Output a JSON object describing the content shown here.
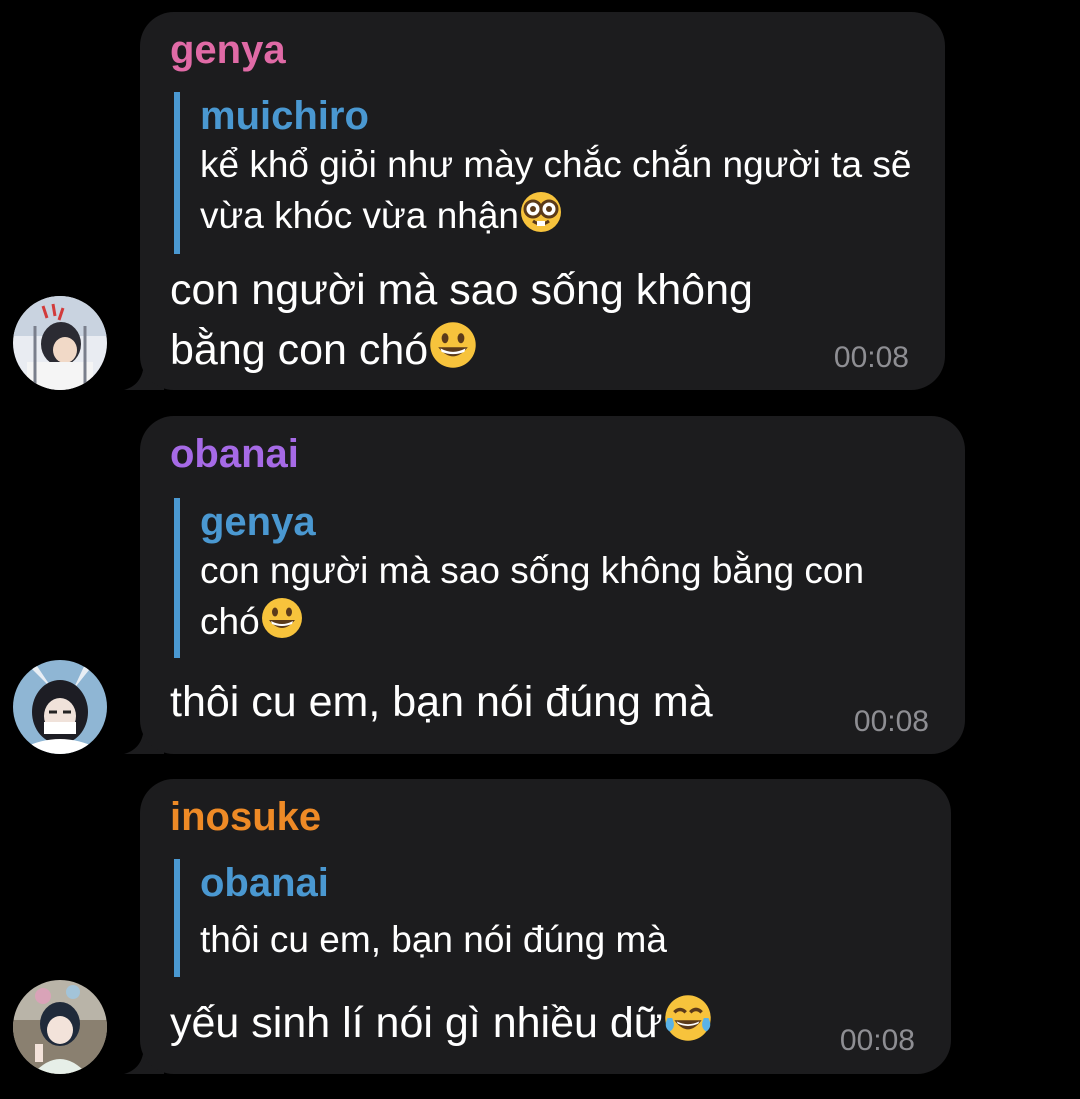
{
  "colors": {
    "background": "#000000",
    "bubble": "#1c1c1e",
    "reply_accent": "#4a98d1",
    "timestamp": "#8e8e93",
    "text": "#ffffff"
  },
  "messages": [
    {
      "sender": "genya",
      "sender_color": "#e06aa6",
      "avatar_icon": "avatar-genya",
      "reply": {
        "author": "muichiro",
        "text": "kể khổ giỏi như mày chắc chắn người ta sẽ vừa khóc vừa nhận",
        "emoji": "nerd-face-emoji"
      },
      "text": "con người mà sao sống không bằng con chó",
      "emoji": "grinning-face-emoji",
      "time": "00:08"
    },
    {
      "sender": "obanai",
      "sender_color": "#a66ae6",
      "avatar_icon": "avatar-obanai",
      "reply": {
        "author": "genya",
        "text": "con người mà sao sống không bằng con chó",
        "emoji": "grinning-face-emoji"
      },
      "text": "thôi cu em, bạn nói đúng mà",
      "emoji": "",
      "time": "00:08"
    },
    {
      "sender": "inosuke",
      "sender_color": "#ee8a26",
      "avatar_icon": "avatar-inosuke",
      "reply": {
        "author": "obanai",
        "text": "thôi cu em, bạn nói đúng mà",
        "emoji": ""
      },
      "text": "yếu sinh lí nói gì nhiều dữ",
      "emoji": "tears-of-joy-emoji",
      "time": "00:08"
    }
  ]
}
